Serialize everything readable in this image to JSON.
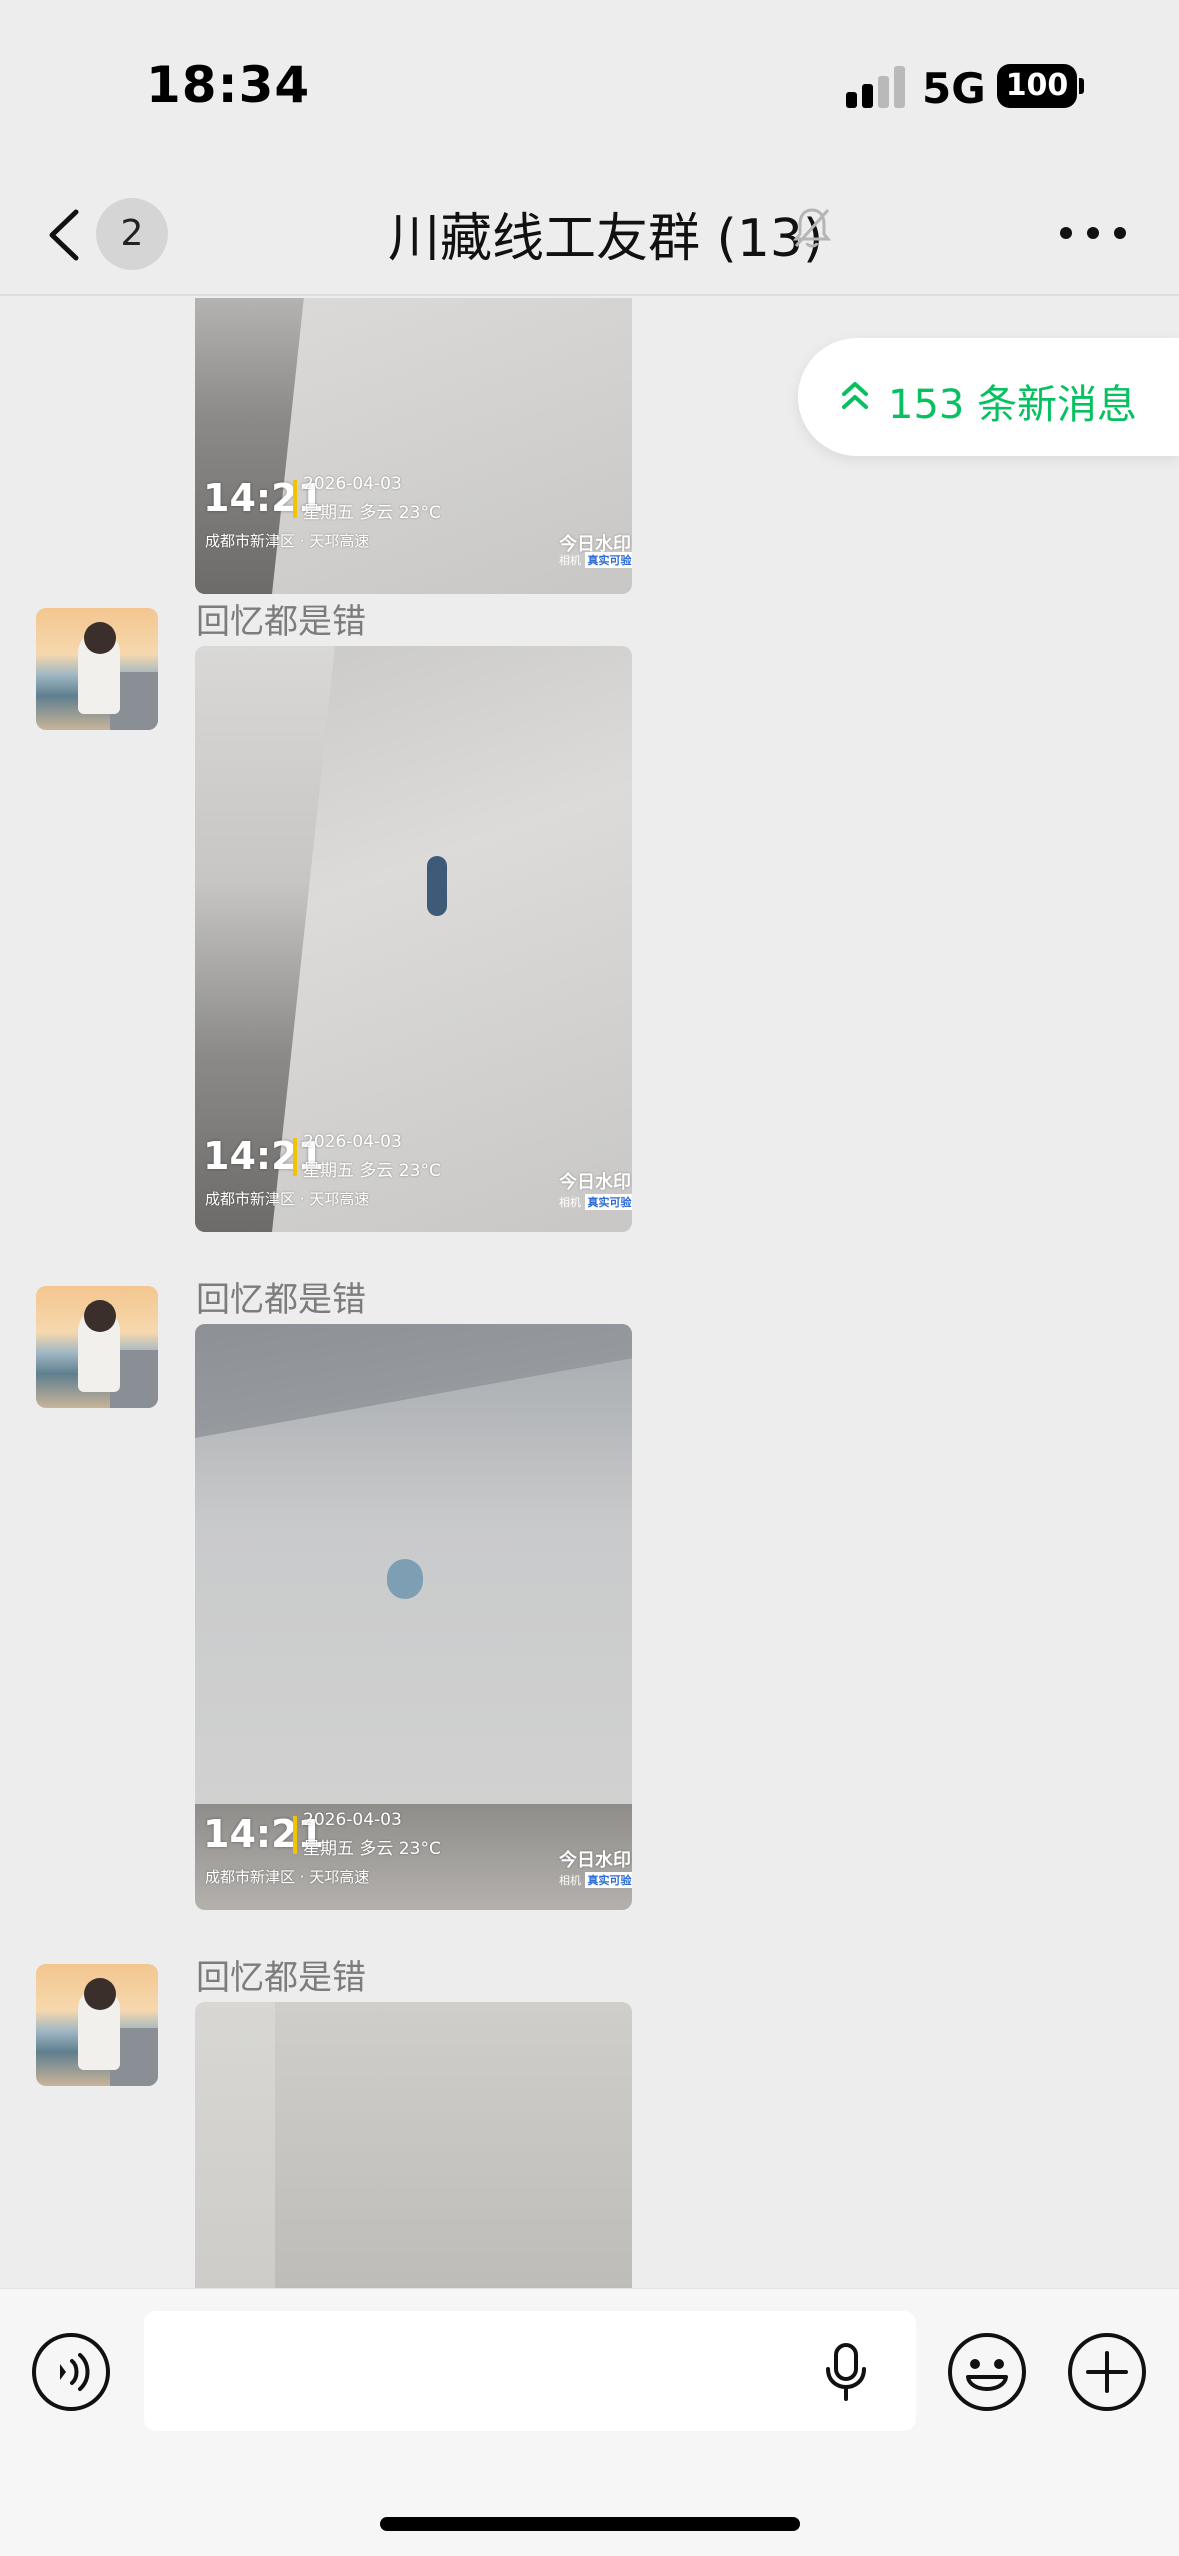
{
  "status_bar": {
    "time": "18:34",
    "network": "5G",
    "battery": "100",
    "signal_bars_active": 2,
    "signal_bars_total": 4
  },
  "nav": {
    "unread_count": "2",
    "title": "川藏线工友群 (13)",
    "muted": true
  },
  "new_messages_pill": {
    "label": "153 条新消息",
    "color": "#07c160"
  },
  "messages": [
    {
      "sender": "",
      "type": "image",
      "watermark": {
        "time": "14:21",
        "date": "2026-04-03",
        "weekday_weather": "星期五  多云 23°C",
        "location": "成都市新津区 · 天邛高速",
        "brand": "今日水印",
        "tag_prefix": "相机",
        "tag": "真实可验"
      }
    },
    {
      "sender": "回忆都是错",
      "type": "image",
      "watermark": {
        "time": "14:21",
        "date": "2026-04-03",
        "weekday_weather": "星期五  多云 23°C",
        "location": "成都市新津区 · 天邛高速",
        "brand": "今日水印",
        "tag_prefix": "相机",
        "tag": "真实可验"
      }
    },
    {
      "sender": "回忆都是错",
      "type": "image",
      "watermark": {
        "time": "14:21",
        "date": "2026-04-03",
        "weekday_weather": "星期五  多云 23°C",
        "location": "成都市新津区 · 天邛高速",
        "brand": "今日水印",
        "tag_prefix": "相机",
        "tag": "真实可验"
      }
    },
    {
      "sender": "回忆都是错",
      "type": "image"
    }
  ],
  "input_bar": {
    "text_value": ""
  }
}
